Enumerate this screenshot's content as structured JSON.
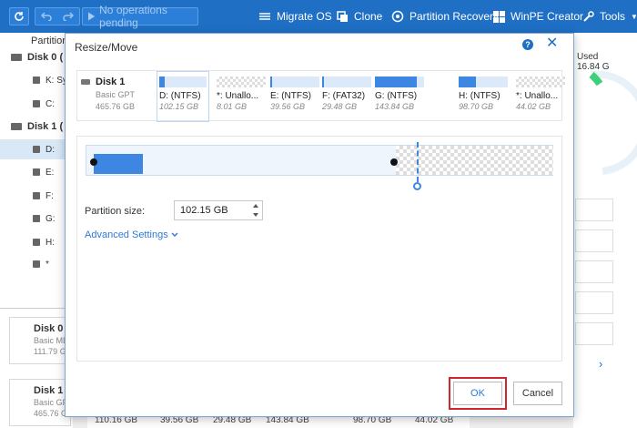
{
  "toolbar": {
    "pending_label": "No operations pending",
    "items": [
      {
        "label": "Migrate OS",
        "icon": "migrate-icon"
      },
      {
        "label": "Clone",
        "icon": "clone-icon"
      },
      {
        "label": "Partition Recovery",
        "icon": "partition-recovery-icon"
      },
      {
        "label": "WinPE Creator",
        "icon": "winpe-icon"
      },
      {
        "label": "Tools",
        "icon": "tools-icon"
      }
    ]
  },
  "left_panel": {
    "header": "Partition",
    "rows": [
      {
        "label": "Disk 0 (",
        "type": "disk"
      },
      {
        "label": "K: Sy",
        "type": "partition"
      },
      {
        "label": "C:",
        "type": "partition"
      },
      {
        "label": "Disk 1 (",
        "type": "disk"
      },
      {
        "label": "D:",
        "type": "partition",
        "selected": true
      },
      {
        "label": "E:",
        "type": "partition"
      },
      {
        "label": "F:",
        "type": "partition"
      },
      {
        "label": "G:",
        "type": "partition"
      },
      {
        "label": "H:",
        "type": "partition"
      },
      {
        "label": "*",
        "type": "partition"
      }
    ],
    "bottom_cards": [
      {
        "name": "Disk 0",
        "sub1": "Basic MB",
        "sub2": "111.79 G"
      },
      {
        "name": "Disk 1",
        "sub1": "Basic GP",
        "sub2": "465.76 G"
      }
    ]
  },
  "right_panel": {
    "used_label": "Used",
    "used_value": "16.84 G"
  },
  "bottom_strip": [
    "110.16 GB",
    "39.56 GB",
    "29.48 GB",
    "143.84 GB",
    "98.70 GB",
    "44.02 GB"
  ],
  "dialog": {
    "title": "Resize/Move",
    "help": "?",
    "close": "✕",
    "disk": {
      "name": "Disk 1",
      "type": "Basic GPT",
      "size": "465.76 GB"
    },
    "partitions": [
      {
        "label": "D: (NTFS)",
        "size": "102.15 GB",
        "style": "blue",
        "fill": 0.12,
        "selected": true
      },
      {
        "label": "*: Unallo...",
        "size": "8.01 GB",
        "style": "checker"
      },
      {
        "label": "E: (NTFS)",
        "size": "39.56 GB",
        "style": "blue",
        "fill": 0.04
      },
      {
        "label": "F: (FAT32)",
        "size": "29.48 GB",
        "style": "blue",
        "fill": 0.04
      },
      {
        "label": "G: (NTFS)",
        "size": "143.84 GB",
        "style": "blue",
        "fill": 0.85
      },
      {
        "label": "H: (NTFS)",
        "size": "98.70 GB",
        "style": "blue",
        "fill": 0.35
      },
      {
        "label": "*: Unallo...",
        "size": "44.02 GB",
        "style": "checker"
      }
    ],
    "partition_size_label": "Partition size:",
    "partition_size_value": "102.15 GB",
    "advanced_settings": "Advanced Settings",
    "ok": "OK",
    "cancel": "Cancel"
  }
}
